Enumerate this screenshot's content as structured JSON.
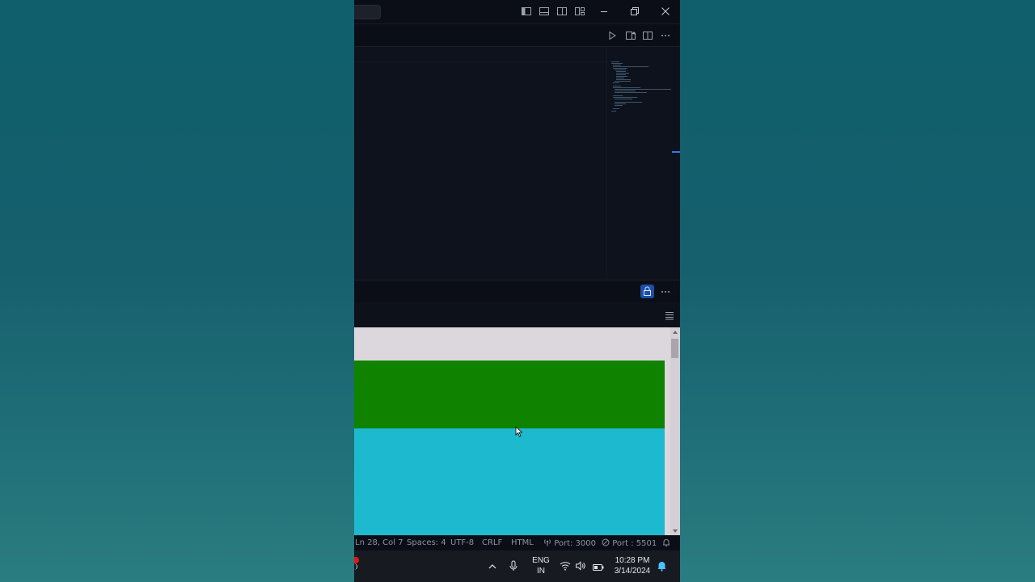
{
  "colors": {
    "desktop": "#0f5f6c",
    "editor_bg": "#0e121c",
    "preview_bg": "#dcd7dc",
    "green_box": "#0f8200",
    "cyan_box": "#1db9cf",
    "accent": "#1e4fa8"
  },
  "titlebar": {
    "icons": [
      "toggle-primary-sidebar-icon",
      "toggle-panel-icon",
      "toggle-secondary-sidebar-icon",
      "customize-layout-icon"
    ],
    "window_controls": [
      "minimize-icon",
      "restore-icon",
      "close-icon"
    ]
  },
  "editor_toolbar": {
    "icons": [
      "run-icon",
      "open-changes-icon",
      "split-editor-icon",
      "more-actions-icon"
    ]
  },
  "panel": {
    "actions": [
      "lock-icon",
      "more-actions-icon"
    ],
    "toolbar_icons": [
      "list-icon"
    ]
  },
  "statusbar": {
    "position": "Ln 28, Col 7",
    "indent": "Spaces: 4",
    "encoding": "UTF-8",
    "eol": "CRLF",
    "language": "HTML",
    "port_forward": "Port: 3000",
    "live_server": "Port : 5501"
  },
  "taskbar": {
    "lang_line1": "ENG",
    "lang_line2": "IN",
    "time": "10:28 PM",
    "date": "3/14/2024",
    "tray_icons": [
      "chevron-up-icon",
      "microphone-icon",
      "wifi-icon",
      "volume-icon",
      "battery-icon",
      "notification-bell-icon"
    ]
  }
}
